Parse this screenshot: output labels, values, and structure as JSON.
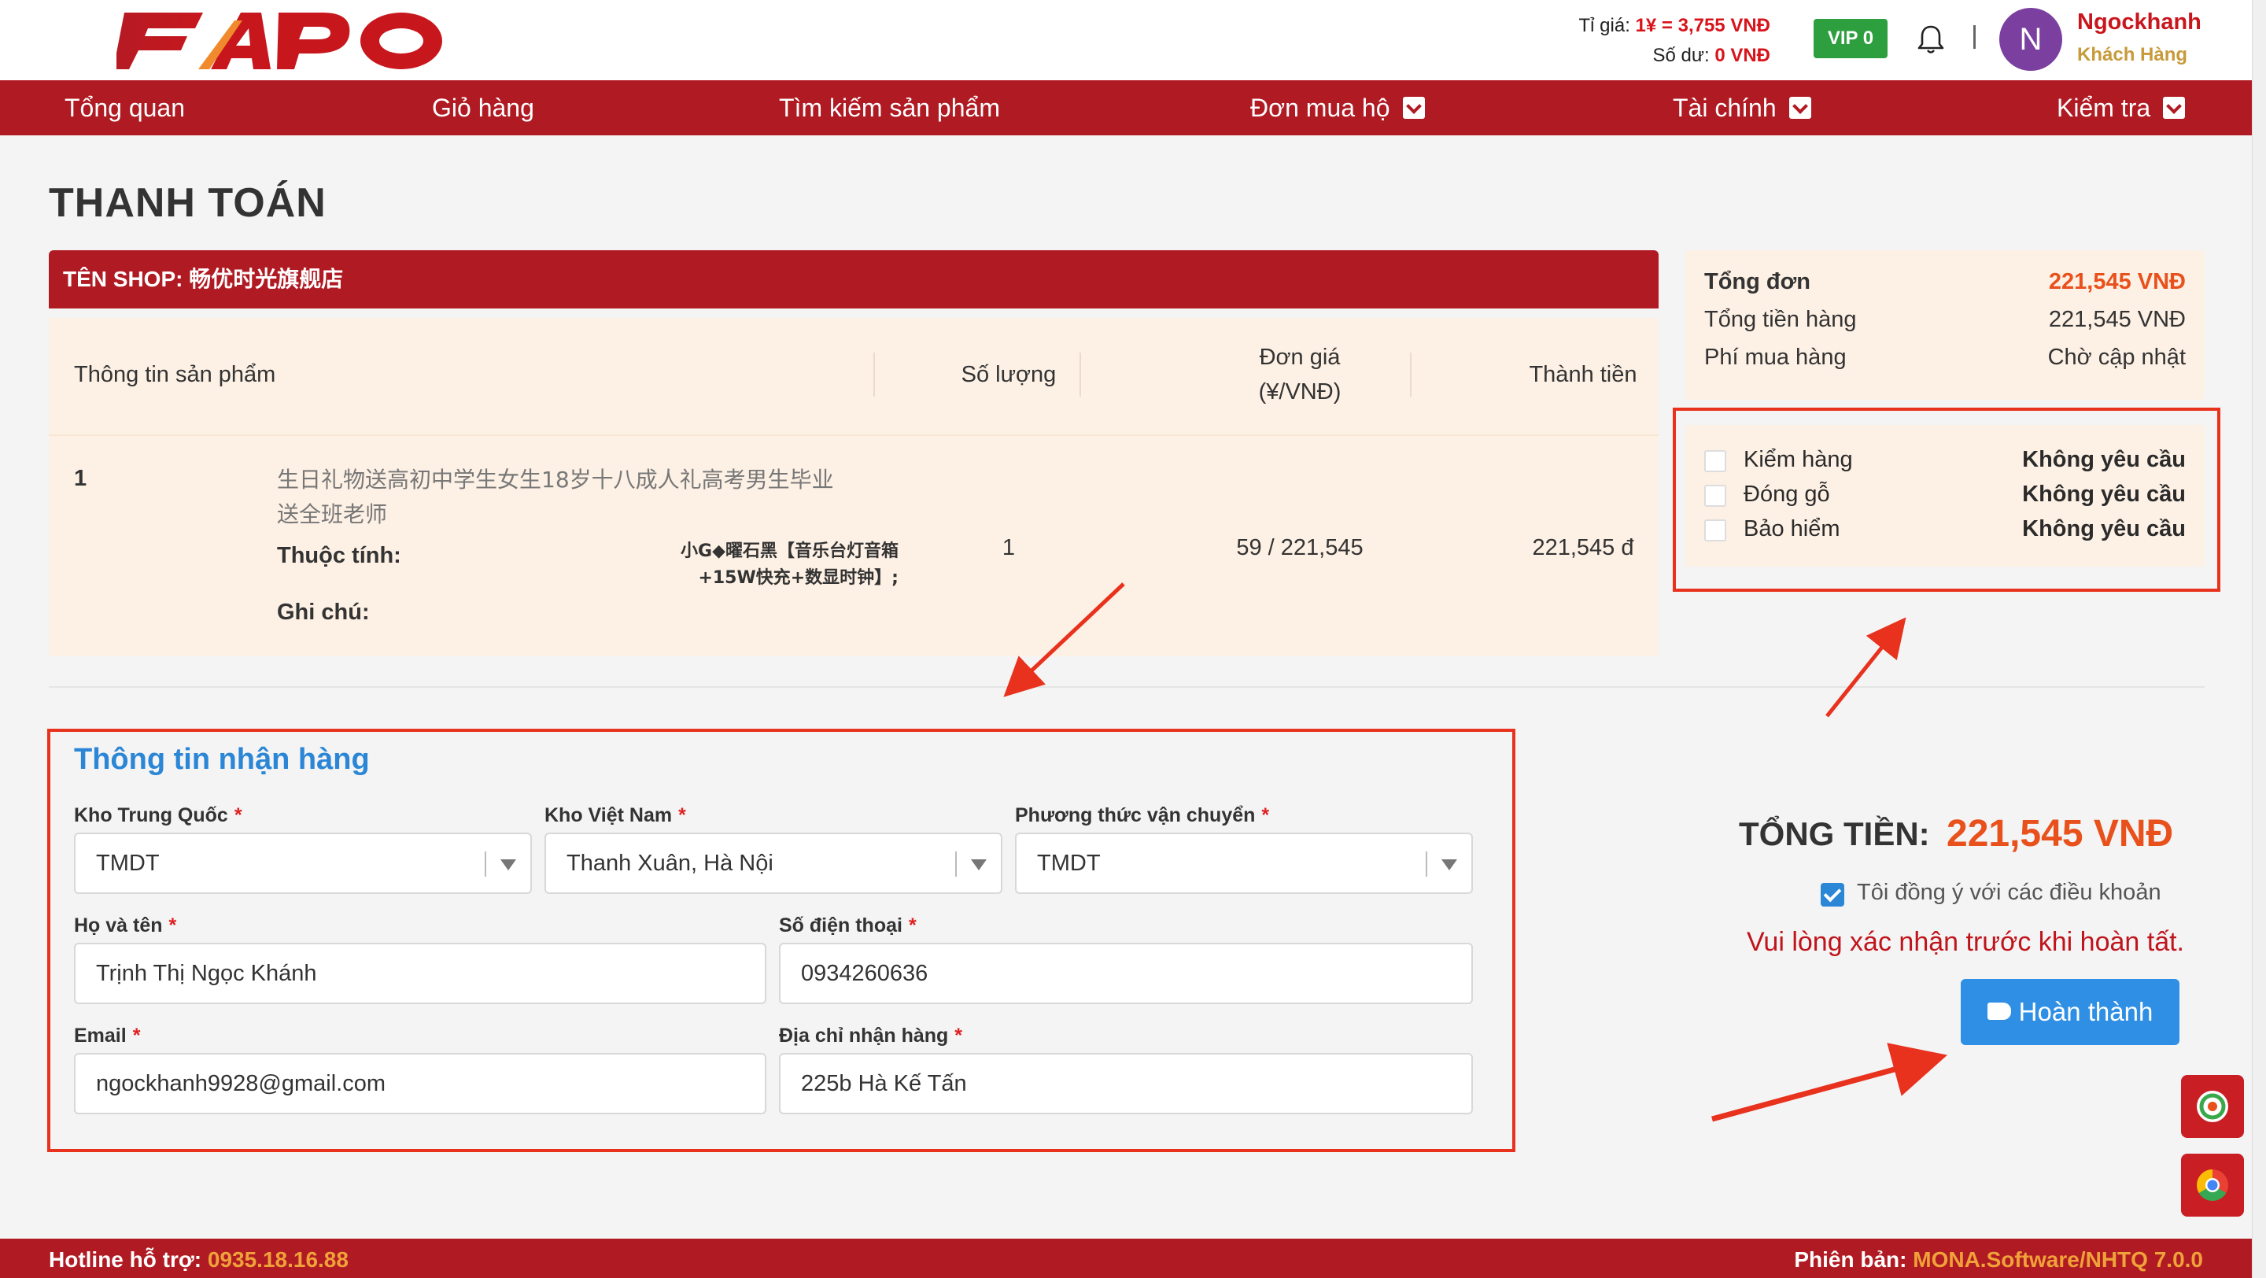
{
  "header": {
    "logo_text": "FAPO",
    "rate_label": "Tỉ giá: ",
    "rate_value": "1¥ = 3,755 VNĐ",
    "balance_label": "Số dư: ",
    "balance_value": "0 VNĐ",
    "vip_label": "VIP 0",
    "avatar_letter": "N",
    "user_name": "Ngockhanh",
    "user_role": "Khách Hàng"
  },
  "nav": {
    "items": [
      {
        "label": "Tổng quan"
      },
      {
        "label": "Giỏ hàng"
      },
      {
        "label": "Tìm kiếm sản phẩm"
      },
      {
        "label": "Đơn mua hộ"
      },
      {
        "label": "Tài chính"
      },
      {
        "label": "Kiểm tra"
      }
    ]
  },
  "page": {
    "title": "THANH TOÁN",
    "shop_label": "TÊN SHOP: 畅优时光旗舰店"
  },
  "table": {
    "headers": {
      "product": "Thông tin sản phẩm",
      "qty": "Số lượng",
      "price_line1": "Đơn giá",
      "price_line2": "(¥/VNĐ)",
      "total": "Thành tiền"
    },
    "row": {
      "index": "1",
      "name_line1": "生日礼物送高初中学生女生18岁十八成人礼高考男生毕业",
      "name_line2": "送全班老师",
      "attr_label": "Thuộc tính:",
      "attr_line1": "小G◆曜石黑【音乐台灯音箱",
      "attr_line2": "+15W快充+数显时钟】;",
      "note_label": "Ghi chú:",
      "qty": "1",
      "price": "59 / 221,545",
      "total": "221,545 đ"
    }
  },
  "summary": {
    "order_total_label": "Tổng đơn",
    "order_total_value": "221,545 VNĐ",
    "goods_label": "Tổng tiền hàng",
    "goods_value": "221,545 VNĐ",
    "fee_label": "Phí mua hàng",
    "fee_value": "Chờ cập nhật"
  },
  "options": [
    {
      "label": "Kiểm hàng",
      "value": "Không yêu cầu"
    },
    {
      "label": "Đóng gỗ",
      "value": "Không yêu cầu"
    },
    {
      "label": "Bảo hiểm",
      "value": "Không yêu cầu"
    }
  ],
  "form": {
    "title": "Thông tin nhận hàng",
    "required_mark": "*",
    "cn_warehouse_label": "Kho Trung Quốc",
    "cn_warehouse_value": "TMDT",
    "vn_warehouse_label": "Kho Việt Nam",
    "vn_warehouse_value": "Thanh Xuân, Hà Nội",
    "shipping_label": "Phương thức vận chuyển",
    "shipping_value": "TMDT",
    "name_label": "Họ và tên",
    "name_value": "Trịnh Thị Ngọc Khánh",
    "phone_label": "Số điện thoại",
    "phone_value": "0934260636",
    "email_label": "Email",
    "email_value": "ngockhanh9928@gmail.com",
    "address_label": "Địa chỉ nhận hàng",
    "address_value": "225b Hà Kế Tấn"
  },
  "checkout": {
    "total_label": "TỔNG TIỀN:",
    "total_value": "221,545 VNĐ",
    "agree_text": "Tôi đồng ý với các điều khoản",
    "warning": "Vui lòng xác nhận trước khi hoàn tất.",
    "finish_label": "Hoàn thành"
  },
  "footer": {
    "hotline_label": "Hotline hỗ trợ: ",
    "hotline_value": "0935.18.16.88",
    "version_label": "Phiên bản: ",
    "version_value": "MONA.Software/NHTQ 7.0.0"
  },
  "colors": {
    "brand_red": "#b01a22",
    "accent_orange": "#e8511c",
    "link_blue": "#2b86d6",
    "annotation_red": "#e8321e"
  }
}
